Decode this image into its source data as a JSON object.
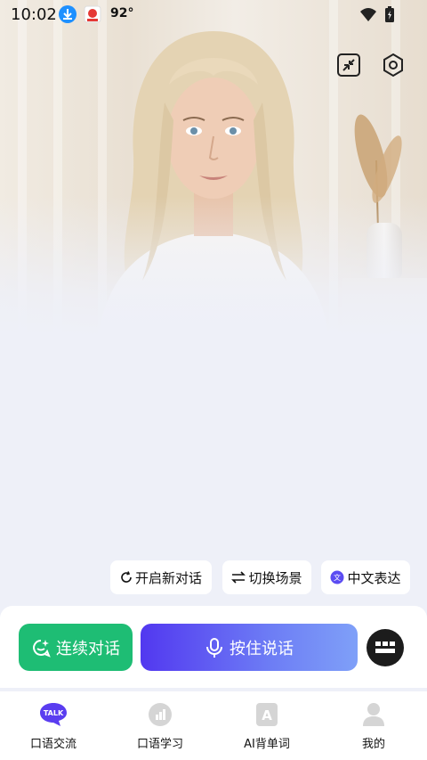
{
  "status_bar": {
    "time": "10:02",
    "temperature": "92°",
    "icons": [
      "download-icon",
      "app-notification-icon",
      "wifi-icon",
      "battery-icon"
    ]
  },
  "top_controls": {
    "icons": [
      "minimize-icon",
      "settings-icon"
    ]
  },
  "chips": {
    "new_conversation": "开启新对话",
    "switch_scene": "切换场景",
    "chinese_expression": "中文表达"
  },
  "actions": {
    "continuous_label": "连续对话",
    "hold_to_talk_label": "按住说话"
  },
  "tabs": [
    {
      "label": "口语交流",
      "icon": "talk-icon",
      "badge": "TALK"
    },
    {
      "label": "口语学习",
      "icon": "learning-icon",
      "badge": ""
    },
    {
      "label": "AI背单词",
      "icon": "vocabulary-icon",
      "badge": "A"
    },
    {
      "label": "我的",
      "icon": "profile-icon",
      "badge": ""
    }
  ],
  "colors": {
    "accent_green": "#1ebd74",
    "accent_purple": "#5238f0",
    "background": "#eef0f8"
  }
}
